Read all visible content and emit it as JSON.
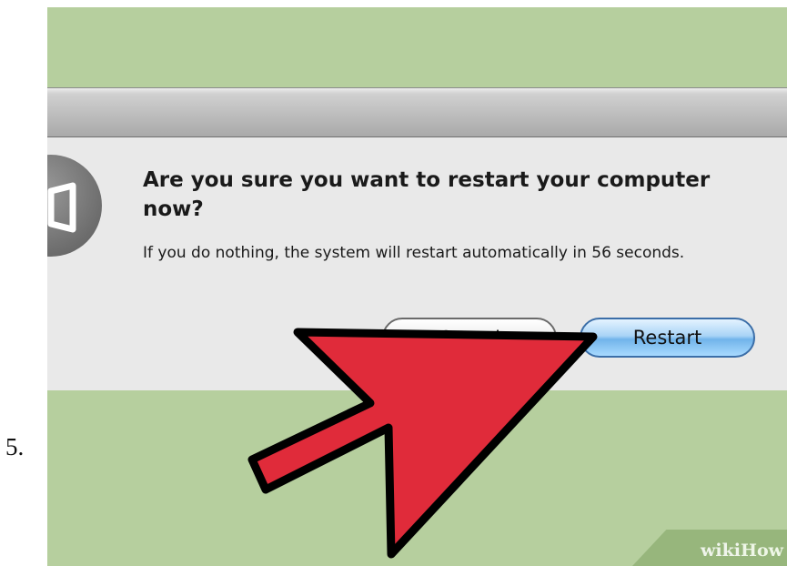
{
  "step": {
    "number": "5."
  },
  "dialog": {
    "title": "Are you sure you want to restart your computer now?",
    "message": "If you do nothing, the system will restart automatically in 56 seconds.",
    "countdown_seconds": 56,
    "buttons": {
      "cancel_label": "Cancel",
      "restart_label": "Restart"
    },
    "icon": "alert-speaker-icon"
  },
  "overlay": {
    "arrow_icon": "pointer-arrow-icon",
    "arrow_color": "#e02b3a"
  },
  "watermark": {
    "part1": "wiki",
    "part2": "How"
  },
  "colors": {
    "background": "#b6cf9e",
    "dialog": "#e9e9e9",
    "restart_button": "#71b4ea"
  }
}
